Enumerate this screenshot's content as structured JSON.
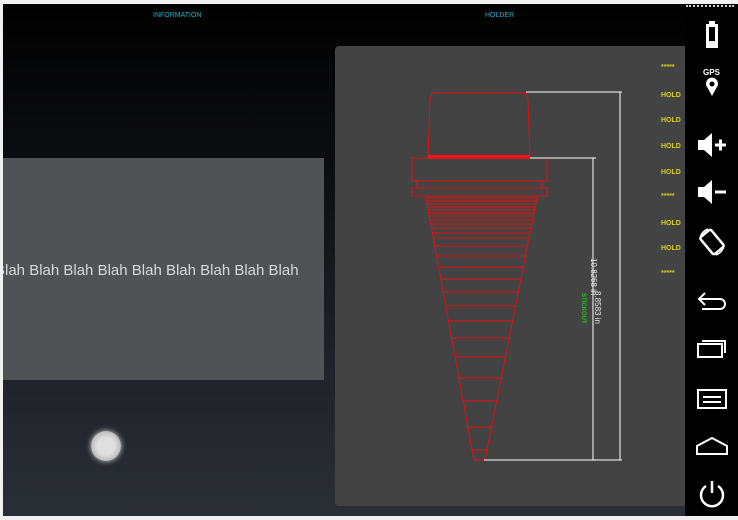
{
  "tabs": {
    "information": "INFORMATION",
    "holder": "HOLDER"
  },
  "info": {
    "blah_text": "Blah Blah Blah Blah Blah Blah Blah Blah Blah"
  },
  "holder": {
    "list": [
      "*****",
      "HOLD",
      "HOLD",
      "HOLD",
      "HOLD",
      "*****",
      "HOLD",
      "HOLD",
      "*****"
    ],
    "overall_length": "10.8268 in",
    "stickout_length": "8.8583 in",
    "stickout_label": "STICKOUT"
  },
  "nav": {
    "gps_label": "GPS"
  },
  "colors": {
    "tool": "#e01010",
    "accent": "#1fb5c8",
    "hold": "#d8d020",
    "stickout": "#20c020"
  }
}
